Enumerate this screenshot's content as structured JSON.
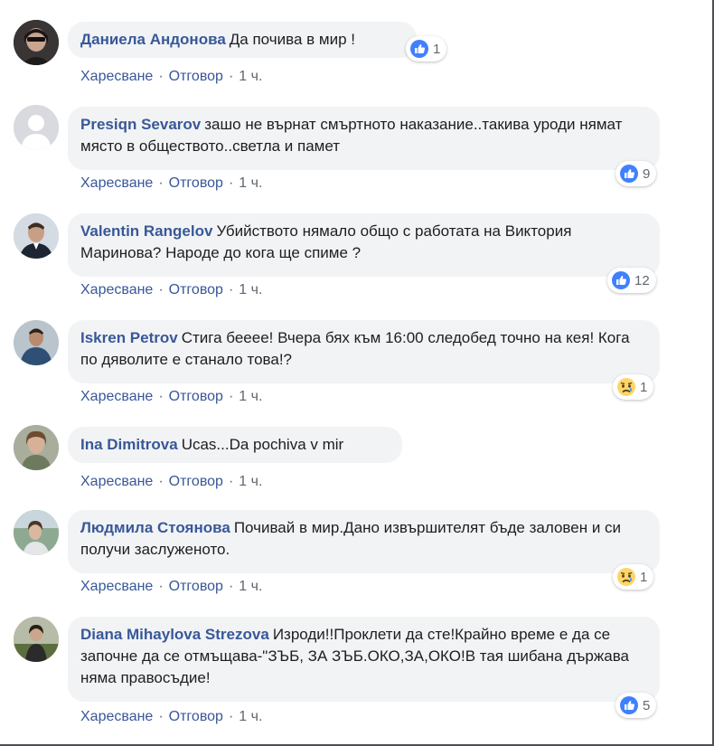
{
  "comments": [
    {
      "author": "Даниела Андонова",
      "text": "Да почива в мир !",
      "like_label": "Харесване",
      "reply_label": "Отговор",
      "time": "1 ч.",
      "reaction": {
        "type": "like-icon",
        "count": "1"
      }
    },
    {
      "author": "Presiqn Sevarov",
      "text": "зашо не върнат смъртното наказание..такива уроди нямат място в обществото..светла и памет",
      "like_label": "Харесване",
      "reply_label": "Отговор",
      "time": "1 ч.",
      "reaction": {
        "type": "like-icon",
        "count": "9"
      }
    },
    {
      "author": "Valentin Rangelov",
      "text": "Убийството нямало общо с работата на Виктория Маринова? Народе до кога ще спиме ?",
      "like_label": "Харесване",
      "reply_label": "Отговор",
      "time": "1 ч.",
      "reaction": {
        "type": "like-icon",
        "count": "12"
      }
    },
    {
      "author": "Iskren Petrov",
      "text": "Стига беееe! Вчера бях към 16:00 следобед точно на кея! Кога по дяволите е станало това!?",
      "like_label": "Харесване",
      "reply_label": "Отговор",
      "time": "1 ч.",
      "reaction": {
        "type": "sad-icon",
        "count": "1"
      }
    },
    {
      "author": "Ina Dimitrova",
      "text": "Ucas...Da pochiva v mir",
      "like_label": "Харесване",
      "reply_label": "Отговор",
      "time": "1 ч.",
      "reaction": null
    },
    {
      "author": "Людмила Стоянова",
      "text": "Почивай в мир.Дано извършителят бъде заловен и си получи заслуженото.",
      "like_label": "Харесване",
      "reply_label": "Отговор",
      "time": "1 ч.",
      "reaction": {
        "type": "sad-icon",
        "count": "1"
      }
    },
    {
      "author": "Diana Mihaylova Strezova",
      "text": "Изроди!!Проклети да сте!Крайно време е да се започне да се отмъщава-\"ЗЪБ, ЗА ЗЪБ.ОКО,ЗА,ОКО!В тая шибана държава няма правосъдие!",
      "like_label": "Харесване",
      "reply_label": "Отговор",
      "time": "1 ч.",
      "reaction": {
        "type": "like-icon",
        "count": "5"
      }
    }
  ],
  "colors": {
    "name": "#385898",
    "bubble": "#f2f3f5",
    "like_blue": "#4080ff",
    "sad_yellow": "#fcd669"
  }
}
